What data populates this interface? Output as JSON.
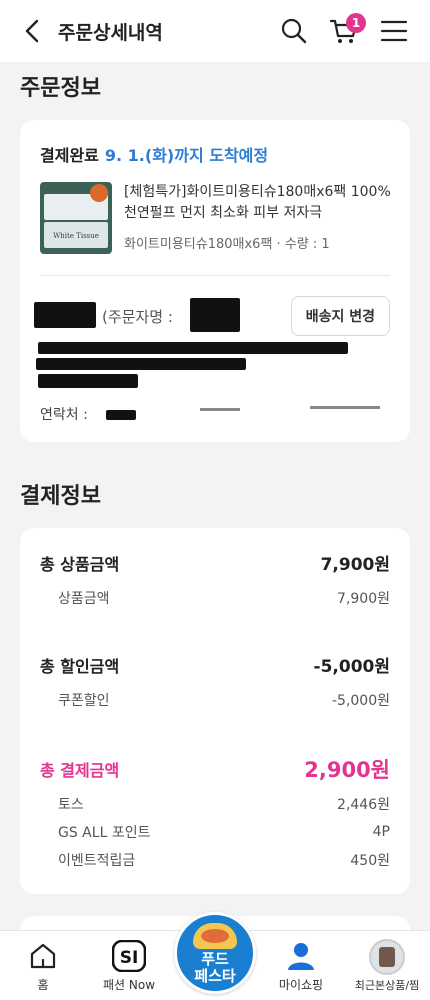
{
  "header": {
    "title": "주문상세내역",
    "cart_count": "1"
  },
  "order_section": {
    "title": "주문정보",
    "status": "결제완료",
    "delivery_date": "9. 1.(화)까지 도착예정",
    "product_name": "[체험특가]화이트미용티슈180매x6팩 100%천연펄프 먼지 최소화 피부 저자극",
    "product_option": "화이트미용티슈180매x6팩 · 수량 : 1",
    "product_image_brand": "White Tissue",
    "orderer_label": "(주문자명 :",
    "change_address_button": "배송지 변경",
    "contact_label": "연락처 :"
  },
  "payment_section": {
    "title": "결제정보",
    "total_product_label": "총 상품금액",
    "total_product_value": "7,900원",
    "product_amount_label": "상품금액",
    "product_amount_value": "7,900원",
    "total_discount_label": "총 할인금액",
    "total_discount_value": "-5,000원",
    "coupon_label": "쿠폰할인",
    "coupon_value": "-5,000원",
    "total_payment_label": "총 결제금액",
    "total_payment_value": "2,900원",
    "methods": [
      {
        "label": "토스",
        "value": "2,446원"
      },
      {
        "label": "GS ALL 포인트",
        "value": "4P"
      },
      {
        "label": "이벤트적립금",
        "value": "450원"
      }
    ]
  },
  "bottom_nav": {
    "home": "홈",
    "fashion_now": "패션 Now",
    "food_festa": "푸드\n페스타",
    "my_shopping": "마이쇼핑",
    "recent": "최근본상품/찜"
  },
  "colors": {
    "accent_pink": "#e2358f",
    "date_blue": "#2f7dd3",
    "nav_blue": "#1a7fd0"
  }
}
